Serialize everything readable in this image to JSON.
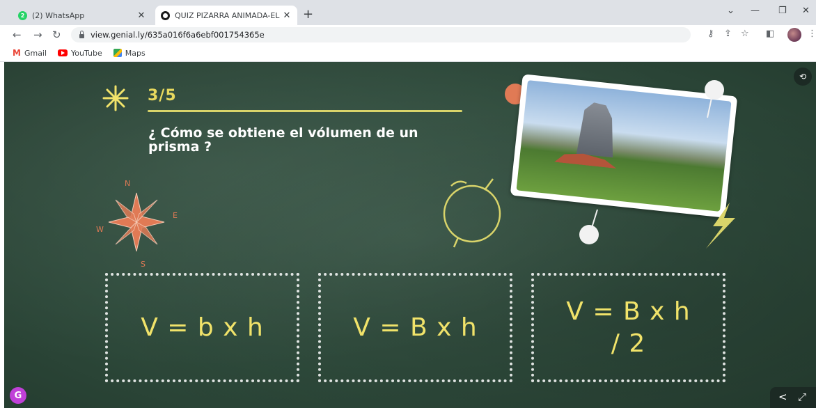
{
  "browser": {
    "tabs": [
      {
        "title": "(2) WhatsApp",
        "badge": "2",
        "active": false
      },
      {
        "title": "QUIZ PIZARRA ANIMADA-EL VOL",
        "active": true
      }
    ],
    "url": "view.genial.ly/635a016f6a6ebf001754365e",
    "bookmarks": [
      "Gmail",
      "YouTube",
      "Maps"
    ]
  },
  "quiz": {
    "counter": "3/5",
    "question": "¿ Cómo se obtiene el vólumen de un prisma ?",
    "compass": {
      "n": "N",
      "e": "E",
      "s": "S",
      "w": "W"
    },
    "answers": [
      "V = b x h",
      "V = B x h",
      "V = B x h / 2"
    ]
  },
  "colors": {
    "board": "#2e4a3b",
    "chalk_yellow": "#f1e36a",
    "chalk_orange": "#e07a55",
    "chalk_white": "#ffffff"
  }
}
